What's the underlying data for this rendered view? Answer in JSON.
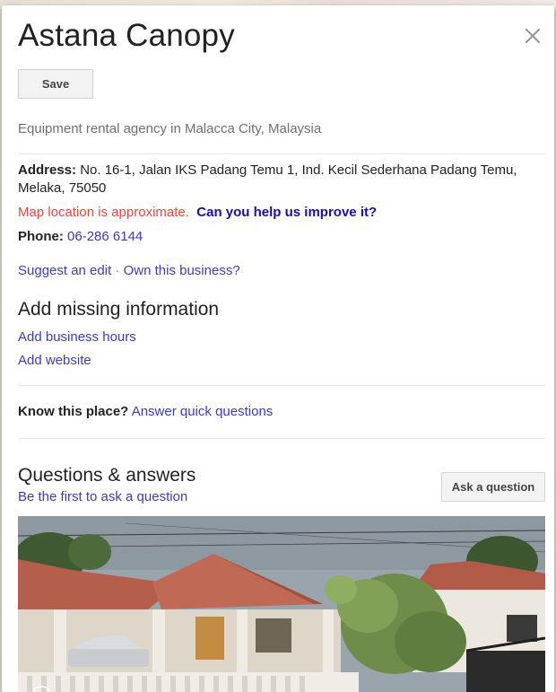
{
  "place": {
    "name": "Astana Canopy",
    "category": "Equipment rental agency in Malacca City, Malaysia"
  },
  "actions": {
    "save_label": "Save",
    "close_icon": "close-icon"
  },
  "info": {
    "address_label": "Address:",
    "address_value": "No. 16-1, Jalan IKS Padang Temu 1, Ind. Kecil Sederhana Padang Temu, Melaka, 75050",
    "approx_text": "Map location is approximate.",
    "help_text": "Can you help us improve it?",
    "phone_label": "Phone:",
    "phone_value": "06-286 6144",
    "suggest_edit": "Suggest an edit",
    "separator": "·",
    "own_business": "Own this business?"
  },
  "missing": {
    "heading": "Add missing information",
    "items": [
      "Add business hours",
      "Add website"
    ]
  },
  "know": {
    "label": "Know this place?",
    "link": "Answer quick questions"
  },
  "qa": {
    "heading": "Questions & answers",
    "first": "Be the first to ask a question",
    "ask_button": "Ask a question"
  },
  "colors": {
    "link": "#3c3cb4",
    "warning": "#dd4b39",
    "help": "#1a0dab",
    "text": "#222222",
    "muted": "#6f6f6f"
  }
}
